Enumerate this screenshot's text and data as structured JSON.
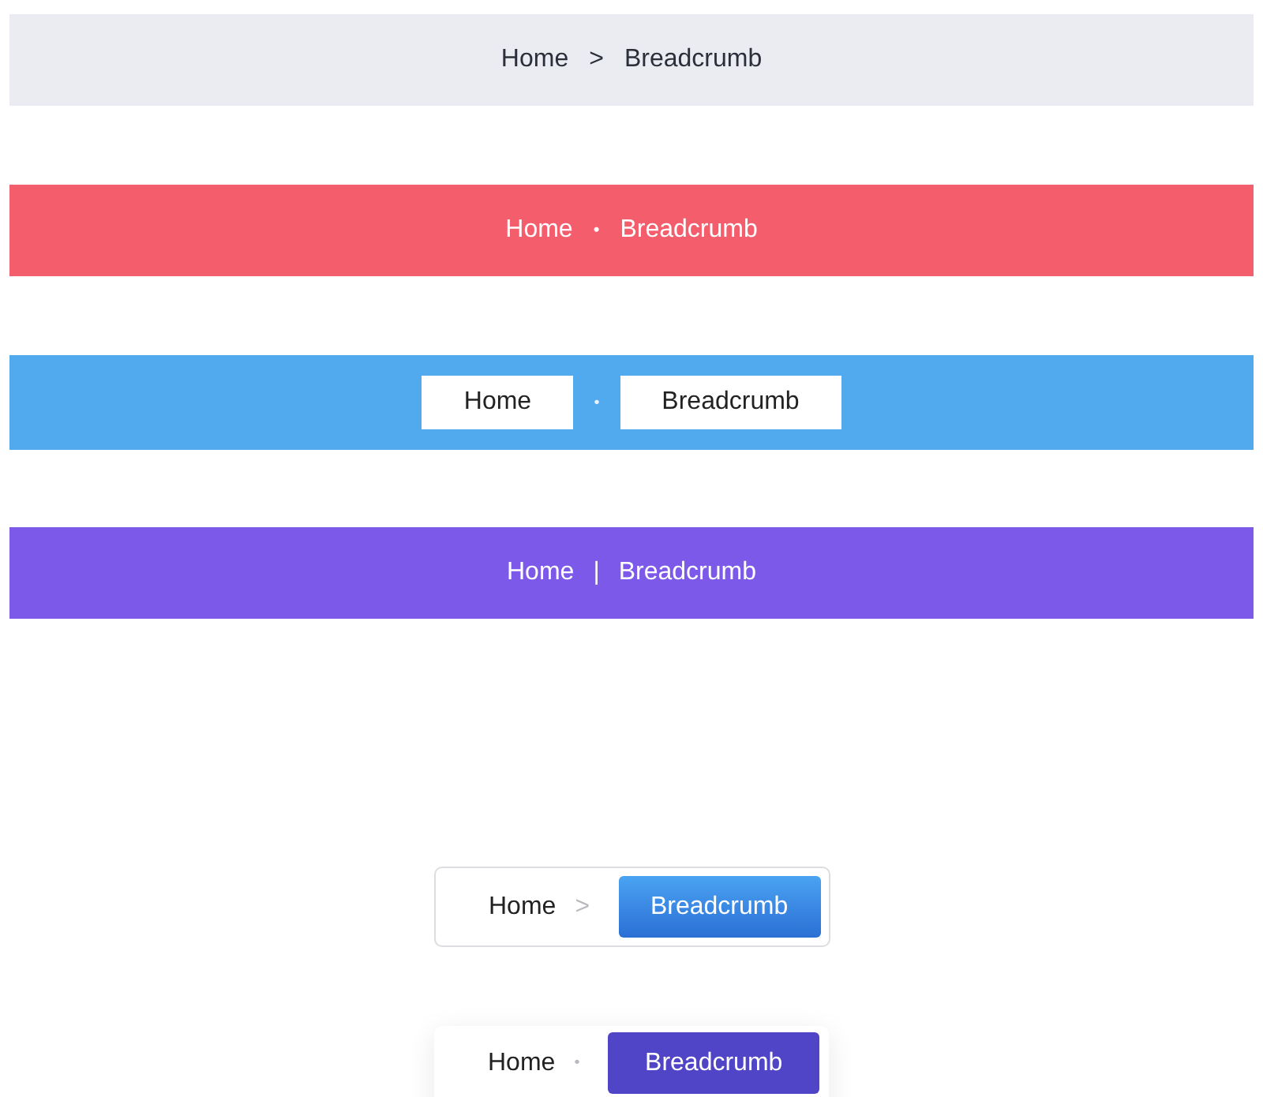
{
  "breadcrumbs": [
    {
      "kind": "plain",
      "separator": ">",
      "items": [
        {
          "label": "Home"
        },
        {
          "label": "Breadcrumb"
        }
      ]
    },
    {
      "kind": "red",
      "separator": "•",
      "items": [
        {
          "label": "Home"
        },
        {
          "label": "Breadcrumb"
        }
      ]
    },
    {
      "kind": "boxed",
      "separator": "•",
      "items": [
        {
          "label": "Home"
        },
        {
          "label": "Breadcrumb"
        }
      ]
    },
    {
      "kind": "purple",
      "separator": "|",
      "items": [
        {
          "label": "Home"
        },
        {
          "label": "Breadcrumb"
        }
      ]
    },
    {
      "kind": "outlined",
      "separator": ">",
      "items": [
        {
          "label": "Home",
          "selected": false
        },
        {
          "label": "Breadcrumb",
          "selected": true
        }
      ]
    },
    {
      "kind": "shadowed",
      "separator": "•",
      "items": [
        {
          "label": "Home",
          "selected": false
        },
        {
          "label": "Breadcrumb",
          "selected": true
        }
      ]
    }
  ]
}
